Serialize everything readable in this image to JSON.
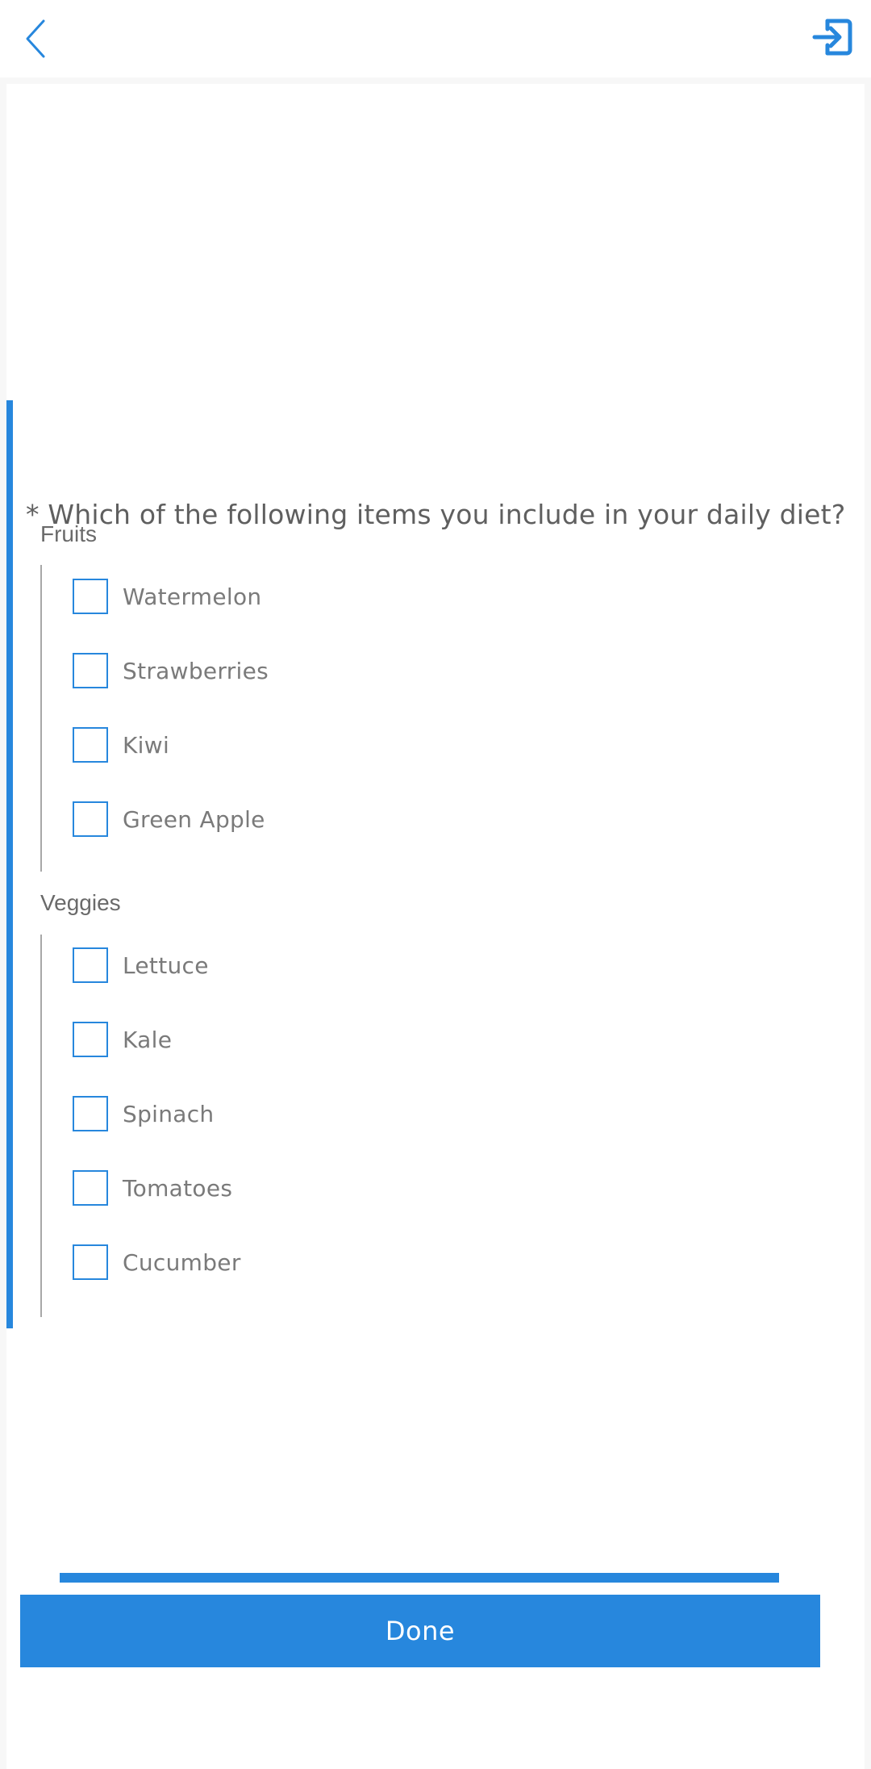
{
  "colors": {
    "accent": "#2787dd",
    "text": "#5f5f5f",
    "muted_text": "#7a7a7a",
    "background": "#f7f7f7",
    "card": "#ffffff"
  },
  "header": {
    "back_icon": "chevron-left-icon",
    "exit_icon": "exit-icon"
  },
  "question": {
    "text": "* Which of the following items you include in your daily diet?",
    "required": true,
    "groups": [
      {
        "label": "Fruits",
        "options": [
          {
            "label": "Watermelon",
            "checked": false
          },
          {
            "label": "Strawberries",
            "checked": false
          },
          {
            "label": "Kiwi",
            "checked": false
          },
          {
            "label": "Green Apple",
            "checked": false
          }
        ]
      },
      {
        "label": "Veggies",
        "options": [
          {
            "label": "Lettuce",
            "checked": false
          },
          {
            "label": "Kale",
            "checked": false
          },
          {
            "label": "Spinach",
            "checked": false
          },
          {
            "label": "Tomatoes",
            "checked": false
          },
          {
            "label": "Cucumber",
            "checked": false
          }
        ]
      }
    ]
  },
  "progress": {
    "fraction": 1.0
  },
  "footer": {
    "done_label": "Done"
  }
}
